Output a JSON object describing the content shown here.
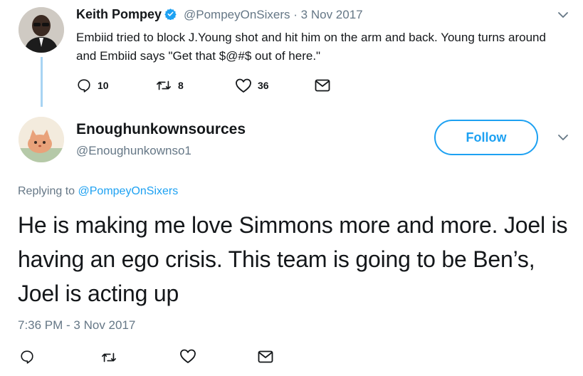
{
  "parent_tweet": {
    "author_name": "Keith Pompey",
    "verified": true,
    "handle": "@PompeyOnSixers",
    "separator": "·",
    "date": "3 Nov 2017",
    "text": "Embiid tried to block J.Young shot and hit him on the arm and back. Young turns around and Embiid says \"Get that $@#$ out of here.\"",
    "actions": {
      "replies": "10",
      "retweets": "8",
      "likes": "36"
    }
  },
  "reply_tweet": {
    "author_name": "Enoughunkownsources",
    "handle": "@Enoughunkownso1",
    "follow_label": "Follow",
    "replying_prefix": "Replying to",
    "replying_to": "@PompeyOnSixers",
    "text": "He is making me love Simmons more and more. Joel is having an ego crisis. This team is going to be Ben’s, Joel is acting up",
    "timestamp": "7:36 PM - 3 Nov 2017"
  },
  "colors": {
    "accent": "#1da1f2",
    "secondary_text": "#657786",
    "thread_line": "#a8d4f3",
    "icon": "#14171a"
  },
  "icons": [
    "verified-badge-icon",
    "chevron-down-icon",
    "reply-icon",
    "retweet-icon",
    "like-icon",
    "direct-message-icon"
  ]
}
